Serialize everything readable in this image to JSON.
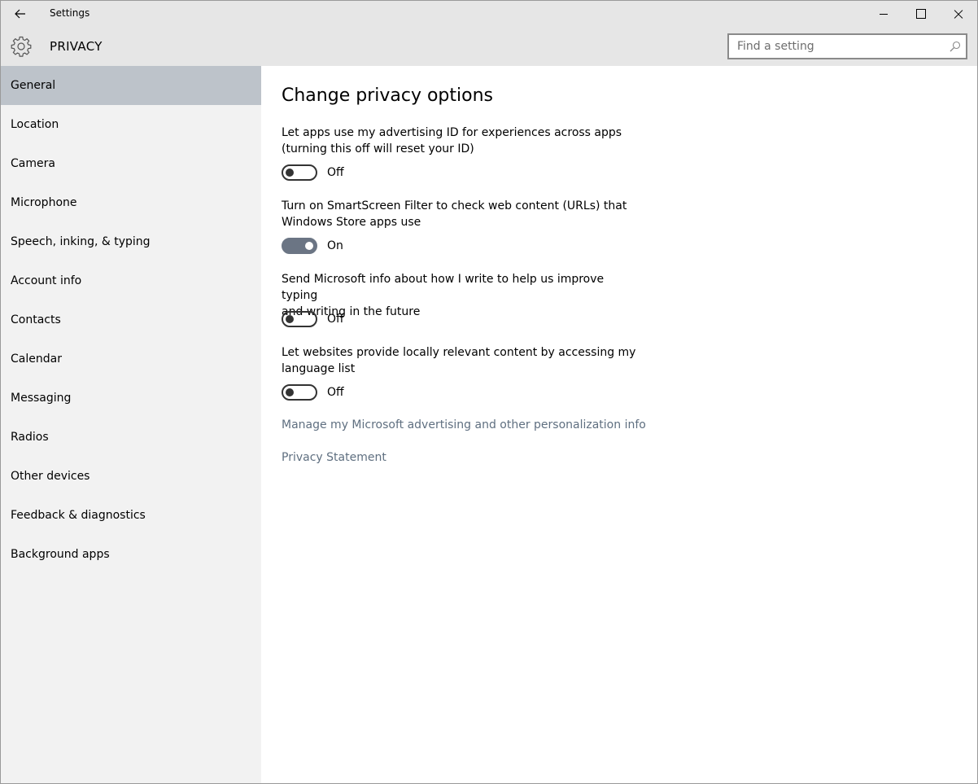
{
  "window": {
    "title": "Settings"
  },
  "header": {
    "title": "PRIVACY",
    "search_placeholder": "Find a setting"
  },
  "sidebar": {
    "selected": "General",
    "items": [
      {
        "label": "General"
      },
      {
        "label": "Location"
      },
      {
        "label": "Camera"
      },
      {
        "label": "Microphone"
      },
      {
        "label": "Speech, inking, & typing"
      },
      {
        "label": "Account info"
      },
      {
        "label": "Contacts"
      },
      {
        "label": "Calendar"
      },
      {
        "label": "Messaging"
      },
      {
        "label": "Radios"
      },
      {
        "label": "Other devices"
      },
      {
        "label": "Feedback & diagnostics"
      },
      {
        "label": "Background apps"
      }
    ]
  },
  "main": {
    "title": "Change privacy options",
    "settings": [
      {
        "line1": "Let apps use my advertising ID for experiences across apps",
        "line2": "(turning this off will reset your ID)",
        "state": "Off"
      },
      {
        "line1": "Turn on SmartScreen Filter to check web content (URLs) that",
        "line2": "Windows Store apps use",
        "state": "On"
      },
      {
        "line1": "Send Microsoft info about how I write to help us improve typing",
        "line2": "and writing in the future",
        "state": "Off"
      },
      {
        "line1": "Let websites provide locally relevant content by accessing my",
        "line2": "language list",
        "state": "Off"
      }
    ],
    "links": [
      {
        "label": "Manage my Microsoft advertising and other personalization info"
      },
      {
        "label": "Privacy Statement"
      }
    ]
  },
  "colors": {
    "titlebar_bg": "#e6e6e6",
    "sidebar_bg": "#f2f2f2",
    "sidebar_selected_bg": "#bdc3ca",
    "toggle_on_bg": "#6b7584",
    "link_color": "#5f6f80"
  }
}
